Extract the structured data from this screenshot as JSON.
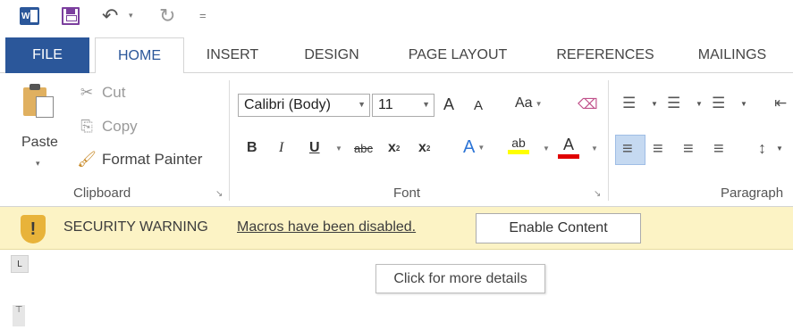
{
  "qat": {
    "app_logo": "word-logo-icon",
    "logo_text": "W",
    "save": "save-icon",
    "undo_glyph": "↶",
    "undo_arrow": "▾",
    "redo_glyph": "↻",
    "customize_glyph": "="
  },
  "tabs": [
    {
      "label": "FILE"
    },
    {
      "label": "HOME"
    },
    {
      "label": "INSERT"
    },
    {
      "label": "DESIGN"
    },
    {
      "label": "PAGE LAYOUT"
    },
    {
      "label": "REFERENCES"
    },
    {
      "label": "MAILINGS"
    }
  ],
  "clipboard": {
    "paste_label": "Paste",
    "paste_arrow": "▾",
    "cut_icon": "✂",
    "cut_label": "Cut",
    "copy_icon": "⎘",
    "copy_label": "Copy",
    "format_painter_icon": "🖌",
    "format_painter_label": "Format Painter",
    "group_label": "Clipboard",
    "launcher": "↘"
  },
  "font": {
    "family": "Calibri (Body)",
    "size": "11",
    "grow": "A",
    "shrink": "A",
    "change_case": "Aa",
    "clear_format": "⌫",
    "bold": "B",
    "italic": "I",
    "underline": "U",
    "strike": "abc",
    "subscript": "x",
    "superscript": "x",
    "effects": "A",
    "highlight": "ab",
    "font_color": "A",
    "group_label": "Font",
    "launcher": "↘",
    "highlight_color": "#ffff00",
    "font_color_value": "#e00000"
  },
  "paragraph": {
    "bullets": "☰",
    "numbering": "☰",
    "multilevel": "☰",
    "indent": "⇤",
    "align_left": "≡",
    "align_center": "≡",
    "align_right": "≡",
    "justify": "≡",
    "line_spacing": "↕",
    "group_label": "Paragraph"
  },
  "security_bar": {
    "title": "SECURITY WARNING",
    "message": "Macros have been disabled.",
    "button": "Enable Content",
    "shield_glyph": "!",
    "color": "#fcf3c5"
  },
  "tooltip": "Click for more details",
  "ruler": {
    "tab_selector": "L",
    "indent_marker": "⊤"
  },
  "colors": {
    "accent": "#2b579a"
  }
}
